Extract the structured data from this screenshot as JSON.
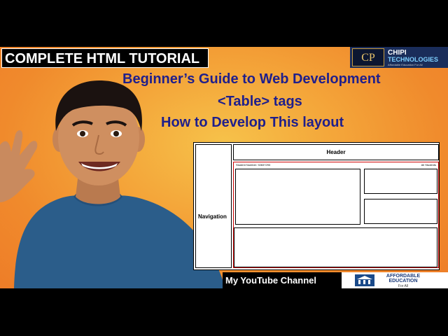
{
  "title": "COMPLETE HTML TUTORIAL",
  "logo": {
    "name_line1": "CHIPI",
    "name_line2": "TECHNOLOGIES",
    "tagline": "Affordable Education For All",
    "mark": "CP"
  },
  "headlines": [
    "Beginner’s Guide to Web Development",
    "<Table> tags",
    "How to Develop This layout"
  ],
  "diagram": {
    "header": "Header",
    "navigation": "Navigation",
    "student_number": "Student Number: 92837293",
    "all_students": "All Students"
  },
  "banner": "My YouTube Channel",
  "affordable": {
    "line1": "AFFORDABLE",
    "line2": "EDUCATION",
    "line3": "For All"
  }
}
